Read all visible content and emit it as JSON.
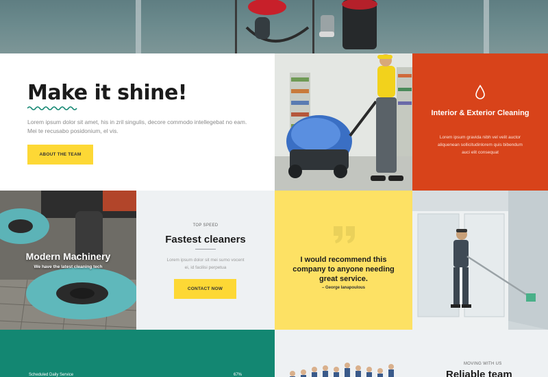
{
  "colors": {
    "accent_yellow": "#fdd835",
    "orange": "#d8431a",
    "quote_yellow": "#fde164",
    "teal": "#138772",
    "light_gray": "#eef1f3"
  },
  "intro": {
    "title": "Make it shine!",
    "text": "Lorem ipsum dolor sit amet, his in zril singulis, decore commodo intellegebat no eam. Mei te recusabo posidonium, el vis.",
    "button": "ABOUT THE TEAM"
  },
  "interior_card": {
    "icon": "water-drop-icon",
    "title": "Interior & Exterior Cleaning",
    "text": "Lorem ipsum gravida nibh vel velit auctor aliquenean sollicitudinlorem quis bibendum auci elit consequat"
  },
  "machinery": {
    "title": "Modern Machinery",
    "subtitle": "We have the latest cleaning tech"
  },
  "fastest": {
    "kicker": "TOP SPEED",
    "title": "Fastest cleaners",
    "text": "Lorem ipsum dolor sit mei sumo vocent ei, id facilisi perpetua",
    "button": "CONTACT NOW"
  },
  "testimonial": {
    "icon": "quote-icon",
    "quote": "I would recommend this company to anyone needing great service.",
    "author": "– George Ianapoulous"
  },
  "services": {
    "label": "Scheduled Daily Service",
    "percent": "67%"
  },
  "team": {
    "kicker": "MOVING WITH US",
    "title": "Reliable team"
  }
}
